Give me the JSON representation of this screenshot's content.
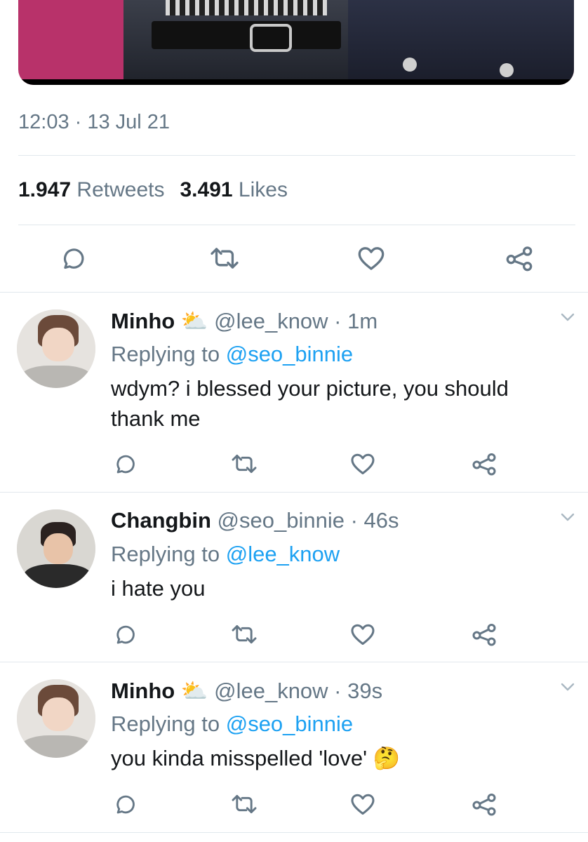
{
  "tweet": {
    "timestamp": "12:03 · 13 Jul 21",
    "retweets_count": "1.947",
    "retweets_label": "Retweets",
    "likes_count": "3.491",
    "likes_label": "Likes"
  },
  "replies": [
    {
      "name": "Minho",
      "name_emoji": "⛅",
      "handle": "@lee_know",
      "time": "1m",
      "replying_prefix": "Replying to",
      "replying_to": "@seo_binnie",
      "text_line1": "wdym? i blessed your picture, you should",
      "text_line2": "thank me"
    },
    {
      "name": "Changbin",
      "handle": "@seo_binnie",
      "time": "46s",
      "replying_prefix": "Replying to",
      "replying_to": "@lee_know",
      "text_line1": "i hate you"
    },
    {
      "name": "Minho",
      "name_emoji": "⛅",
      "handle": "@lee_know",
      "time": "39s",
      "replying_prefix": "Replying to",
      "replying_to": "@seo_binnie",
      "text_line1": "you kinda misspelled 'love'",
      "text_emoji": "🤔"
    }
  ],
  "colors": {
    "accent": "#1da1f2",
    "secondary_text": "#657786",
    "divider": "#e1e8ed"
  },
  "icons": [
    "reply-icon",
    "retweet-icon",
    "like-icon",
    "share-icon",
    "chevron-down-icon"
  ]
}
